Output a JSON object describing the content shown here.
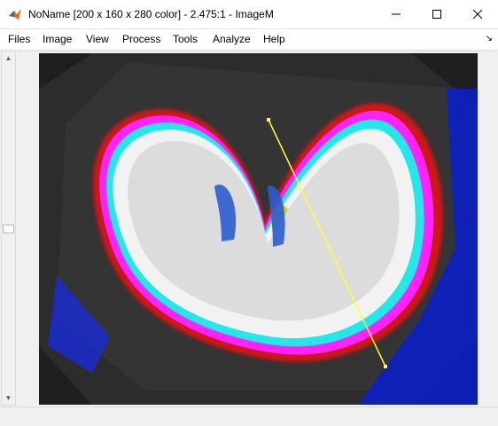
{
  "window": {
    "title": "NoName [200 x 160 x 280 color] - 2.475:1 - ImageM",
    "icon": "matlab-icon",
    "controls": [
      "minimize-icon",
      "maximize-icon",
      "close-icon"
    ]
  },
  "menu": {
    "items": [
      {
        "label": "Files"
      },
      {
        "label": "Image"
      },
      {
        "label": "View"
      },
      {
        "label": "Process"
      },
      {
        "label": "Tools"
      },
      {
        "label": "Analyze"
      },
      {
        "label": "Help"
      }
    ],
    "collapse_icon": "dock-arrow-icon"
  },
  "colors": {
    "line": "#ffff33",
    "background": "#f0f0f0",
    "image_bg": "#1f1f1f"
  }
}
